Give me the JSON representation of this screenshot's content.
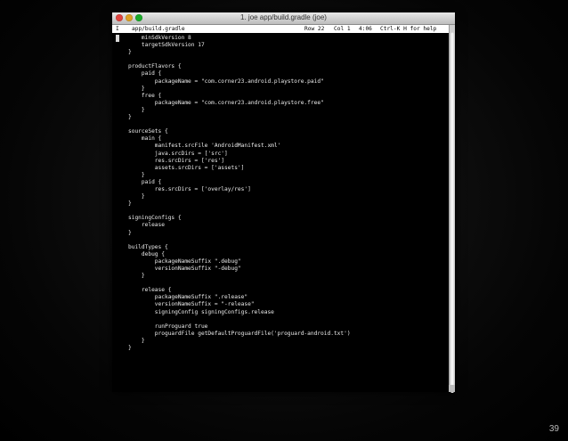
{
  "window": {
    "title": "1. joe app/build.gradle (joe)",
    "buttons": {
      "close": "close",
      "minimize": "minimize",
      "zoom": "zoom"
    }
  },
  "status_bar": {
    "mode": "I",
    "file": "app/build.gradle",
    "row": "Row 22",
    "col": "Col 1",
    "time": "4:06",
    "help": "Ctrl-K H for help"
  },
  "code_lines": [
    "    minSdkVersion 8",
    "    targetSdkVersion 17",
    "}",
    "",
    "productFlavors {",
    "    paid {",
    "        packageName = \"com.corner23.android.playstore.paid\"",
    "    }",
    "    free {",
    "        packageName = \"com.corner23.android.playstore.free\"",
    "    }",
    "}",
    "",
    "sourceSets {",
    "    main {",
    "        manifest.srcFile 'AndroidManifest.xml'",
    "        java.srcDirs = ['src']",
    "        res.srcDirs = ['res']",
    "        assets.srcDirs = ['assets']",
    "    }",
    "    paid {",
    "        res.srcDirs = ['overlay/res']",
    "    }",
    "}",
    "",
    "signingConfigs {",
    "    release",
    "}",
    "",
    "buildTypes {",
    "    debug {",
    "        packageNameSuffix \".debug\"",
    "        versionNameSuffix \"-debug\"",
    "    }",
    "",
    "    release {",
    "        packageNameSuffix \".release\"",
    "        versionNameSuffix = \"-release\"",
    "        signingConfig signingConfigs.release",
    "",
    "        runProguard true",
    "        proguardFile getDefaultProguardFile('proguard-android.txt')",
    "    }",
    "}"
  ],
  "page_number": "39"
}
